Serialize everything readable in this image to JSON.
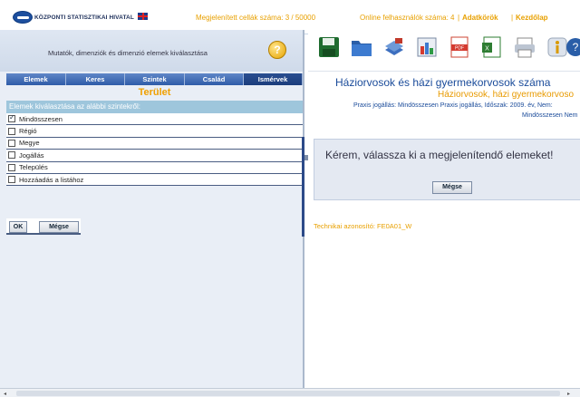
{
  "header": {
    "logo_text": "KÖZPONTI STATISZTIKAI HIVATAL",
    "language_flag": "english-flag-icon",
    "cells_label": "Megjelenített cellák száma: 3 / 50000",
    "users_label": "Online felhasználók száma: 4",
    "link_separator": "|",
    "link_data_sources": "Adatkörök",
    "link_home": "Kezdőlap"
  },
  "left": {
    "title": "Mutatók, dimenziók és dimenzió elemek kiválasztása",
    "help_icon": "?",
    "tabs": [
      {
        "label": "Elemek"
      },
      {
        "label": "Keres"
      },
      {
        "label": "Szintek"
      },
      {
        "label": "Család"
      },
      {
        "label": "Ismérvek"
      }
    ],
    "area_title": "Terület",
    "level_prompt": "Elemek kiválasztása az alábbi szintekről:",
    "levels": [
      {
        "label": "Mindösszesen",
        "checked": true
      },
      {
        "label": "Régió",
        "checked": false
      },
      {
        "label": "Megye",
        "checked": false
      },
      {
        "label": "Jogállás",
        "checked": false
      },
      {
        "label": "Település",
        "checked": false
      },
      {
        "label": "Hozzáadás a listához",
        "checked": false
      }
    ],
    "ok_label": "OK",
    "cancel_label": "Mégse"
  },
  "right": {
    "toolbar_icons": [
      "save-icon",
      "folder-icon",
      "toggle-view-icon",
      "chart-icon",
      "pdf-icon",
      "excel-icon",
      "print-icon",
      "info-icon",
      "help-icon"
    ],
    "title_main": "Háziorvosok és házi gyermekorvosok száma",
    "title_sub": "Háziorvosok, házi gyermekorvoso",
    "subtitle_line1": "Praxis jogállás: Mindösszesen Praxis jogállás, Időszak: 2009. év, Nem:",
    "subtitle_line2": "Mindösszesen Nem",
    "notice": "Kérem, válassza ki a megjelenítendő elemeket!",
    "cancel_label": "Mégse",
    "tech_id": "Technikai azonosító: FE0A01_W"
  },
  "scrollbar": {
    "left_arrow": "◂",
    "right_arrow": "▸"
  },
  "colors": {
    "accent_orange": "#e8a000",
    "title_blue": "#1a4b9a",
    "tab_blue": "#2f5ca8",
    "level_bar": "#9ec6dc"
  }
}
